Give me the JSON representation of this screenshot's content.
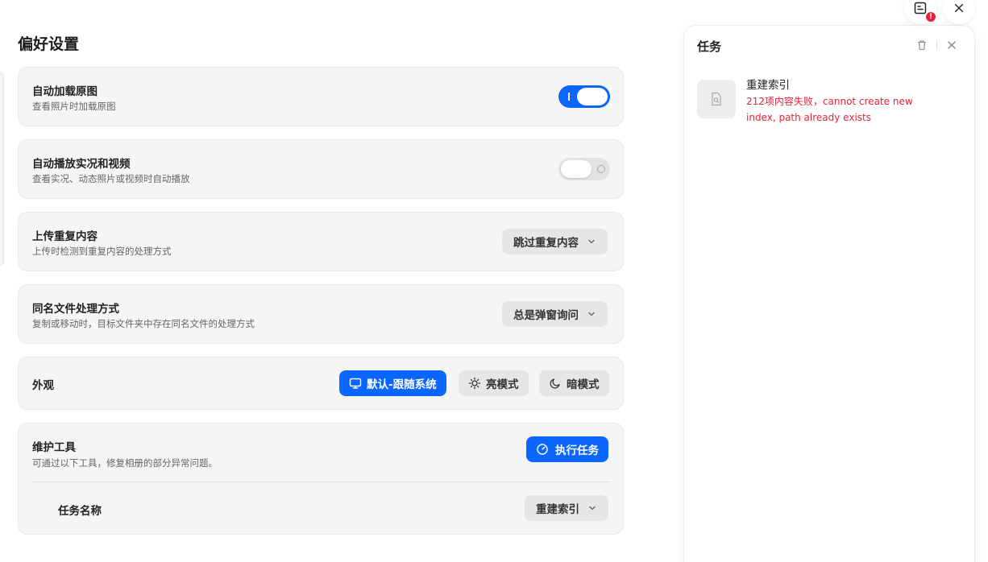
{
  "page": {
    "title": "偏好设置"
  },
  "settings": {
    "auto_load_original": {
      "title": "自动加载原图",
      "subtitle": "查看照片时加载原图",
      "enabled": true
    },
    "autoplay_live": {
      "title": "自动播放实况和视频",
      "subtitle": "查看实况、动态照片或视频时自动播放",
      "enabled": false
    },
    "upload_duplicates": {
      "title": "上传重复内容",
      "subtitle": "上传时检测到重复内容的处理方式",
      "selected": "跳过重复内容"
    },
    "same_name_files": {
      "title": "同名文件处理方式",
      "subtitle": "复制或移动时，目标文件夹中存在同名文件的处理方式",
      "selected": "总是弹窗询问"
    },
    "appearance": {
      "title": "外观",
      "options": [
        "默认-跟随系统",
        "亮模式",
        "暗模式"
      ],
      "selected": "默认-跟随系统"
    },
    "maintenance": {
      "title": "维护工具",
      "subtitle": "可通过以下工具，修复相册的部分异常问题。",
      "run_label": "执行任务",
      "task_name_label": "任务名称",
      "task_selected": "重建索引"
    }
  },
  "tasks_panel": {
    "title": "任务",
    "items": [
      {
        "name": "重建索引",
        "error": "212项内容失败，cannot create new index, path already exists"
      }
    ]
  },
  "topbar": {
    "badge": "!"
  },
  "colors": {
    "accent": "#0a66ff",
    "error": "#e8213d"
  },
  "icons": [
    "task-list-icon",
    "close-icon",
    "trash-icon",
    "chevron-down-icon",
    "monitor-icon",
    "sun-icon",
    "moon-icon",
    "gauge-icon",
    "file-search-icon"
  ]
}
